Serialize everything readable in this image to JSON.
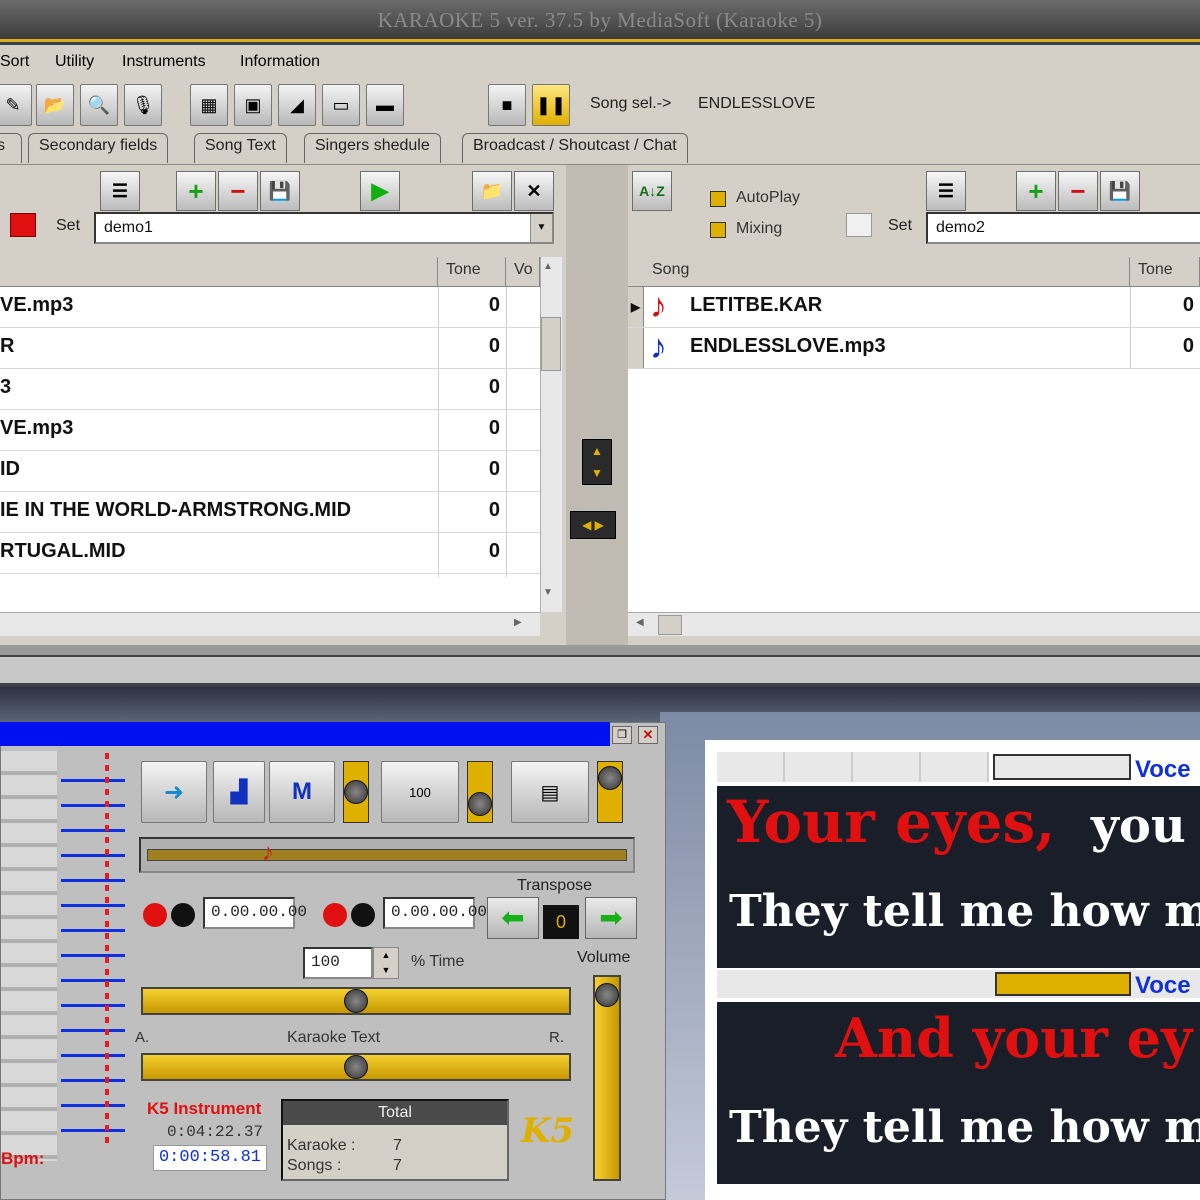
{
  "window": {
    "title": "KARAOKE 5   ver. 37.5 by MediaSoft (Karaoke 5)"
  },
  "menu": {
    "items": [
      "Sort",
      "Utility",
      "Instruments",
      "Information"
    ]
  },
  "toolbar": {
    "song_sel_label": "Song sel.->",
    "song_sel_value": "ENDLESSLOVE"
  },
  "tabs": [
    "s",
    "Secondary fields",
    "Song Text",
    "Singers shedule",
    "Broadcast / Shoutcast / Chat"
  ],
  "left_set": {
    "set_label": "Set",
    "set_value": "demo1",
    "columns": [
      "Tone",
      "Vo"
    ],
    "rows": [
      {
        "name": "VE.mp3",
        "tone": "0"
      },
      {
        "name": "R",
        "tone": "0"
      },
      {
        "name": "3",
        "tone": "0"
      },
      {
        "name": "VE.mp3",
        "tone": "0"
      },
      {
        "name": "ID",
        "tone": "0"
      },
      {
        "name": "IE IN THE WORLD-ARMSTRONG.MID",
        "tone": "0"
      },
      {
        "name": "RTUGAL.MID",
        "tone": "0"
      }
    ]
  },
  "right_set": {
    "autoplay_label": "AutoPlay",
    "mixing_label": "Mixing",
    "set_label": "Set",
    "set_value": "demo2",
    "columns": [
      "Song",
      "Tone"
    ],
    "rows": [
      {
        "name": "LETITBE.KAR",
        "tone": "0"
      },
      {
        "name": "ENDLESSLOVE.mp3",
        "tone": "0"
      }
    ]
  },
  "player": {
    "time_a": "0.00.00.00",
    "time_b": "0.00.00.00",
    "transpose_label": "Transpose",
    "transpose_value": "0",
    "time_pct_value": "100",
    "time_pct_label": "% Time",
    "volume_label": "Volume",
    "a_label": "A.",
    "karaoke_text_label": "Karaoke Text",
    "r_label": "R.",
    "instrument_label": "K5 Instrument",
    "elapsed": "0:04:22.37",
    "position": "0:00:58.81",
    "bpm": "Bpm:",
    "total_label": "Total",
    "karaoke_label": "Karaoke :",
    "karaoke_count": "7",
    "songs_label": "Songs   :",
    "songs_count": "7",
    "gauge_value": "100",
    "logo_text": "K5",
    "seek_position": 0.24,
    "balance_position": 0.5,
    "text_position": 0.5
  },
  "lyrics": {
    "voice1_label": "Voce",
    "line1_sung": "Your eyes,",
    "line1_rest": "you",
    "line2": "They tell me how much",
    "voice2_label": "Voce",
    "line3": "And your ey",
    "line4": "They tell me how much"
  },
  "colors": {
    "accent_yellow": "#e0b000",
    "blue_bar": "#0010f0",
    "lyric_red": "#e01010"
  }
}
